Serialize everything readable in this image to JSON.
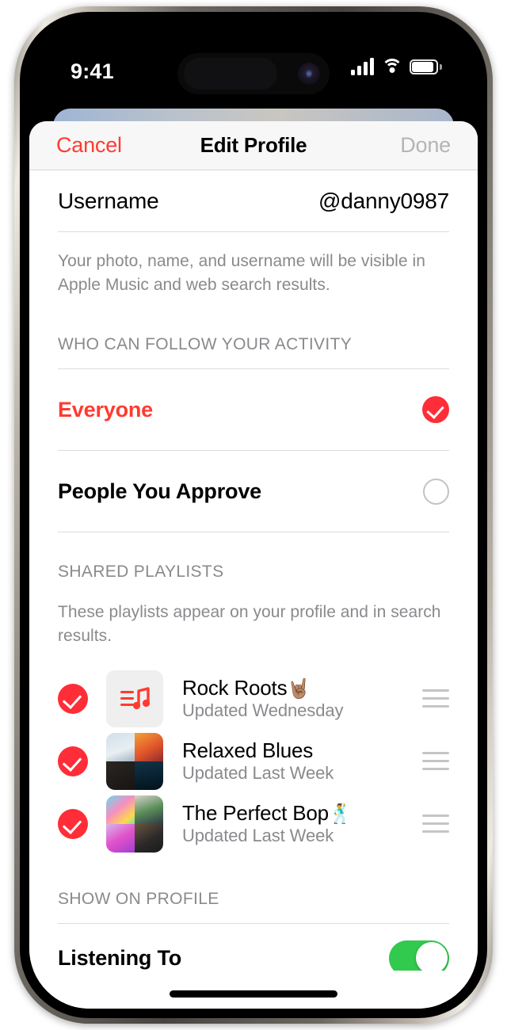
{
  "status_bar": {
    "time": "9:41",
    "cellular_icon": "cellular-signal-icon",
    "wifi_icon": "wifi-icon",
    "battery_icon": "battery-icon"
  },
  "navbar": {
    "cancel_label": "Cancel",
    "title": "Edit Profile",
    "done_label": "Done"
  },
  "username_row": {
    "label": "Username",
    "value": "@danny0987"
  },
  "profile_footnote": "Your photo, name, and username will be visible in Apple Music and web search results.",
  "follow_section": {
    "header": "WHO CAN FOLLOW YOUR ACTIVITY",
    "options": [
      {
        "label": "Everyone",
        "selected": true
      },
      {
        "label": "People You Approve",
        "selected": false
      }
    ]
  },
  "playlists_section": {
    "header": "SHARED PLAYLISTS",
    "footnote": "These playlists appear on your profile and in search results.",
    "items": [
      {
        "title": "Rock Roots",
        "emoji": "🤘🏽",
        "subtitle": "Updated Wednesday",
        "checked": true,
        "artwork_type": "playlist-note-icon"
      },
      {
        "title": "Relaxed Blues",
        "emoji": "",
        "subtitle": "Updated Last Week",
        "checked": true,
        "artwork_type": "album-collage"
      },
      {
        "title": "The Perfect Bop",
        "emoji": "🕺",
        "subtitle": "Updated Last Week",
        "checked": true,
        "artwork_type": "album-collage"
      }
    ]
  },
  "show_on_profile": {
    "header": "SHOW ON PROFILE",
    "rows": [
      {
        "label": "Listening To",
        "enabled": true
      }
    ]
  },
  "colors": {
    "accent_red": "#ff3b30",
    "check_red": "#ff2d37",
    "toggle_green": "#31c94e",
    "secondary_text": "#8a8a8e",
    "separator": "#dcdcdc"
  }
}
